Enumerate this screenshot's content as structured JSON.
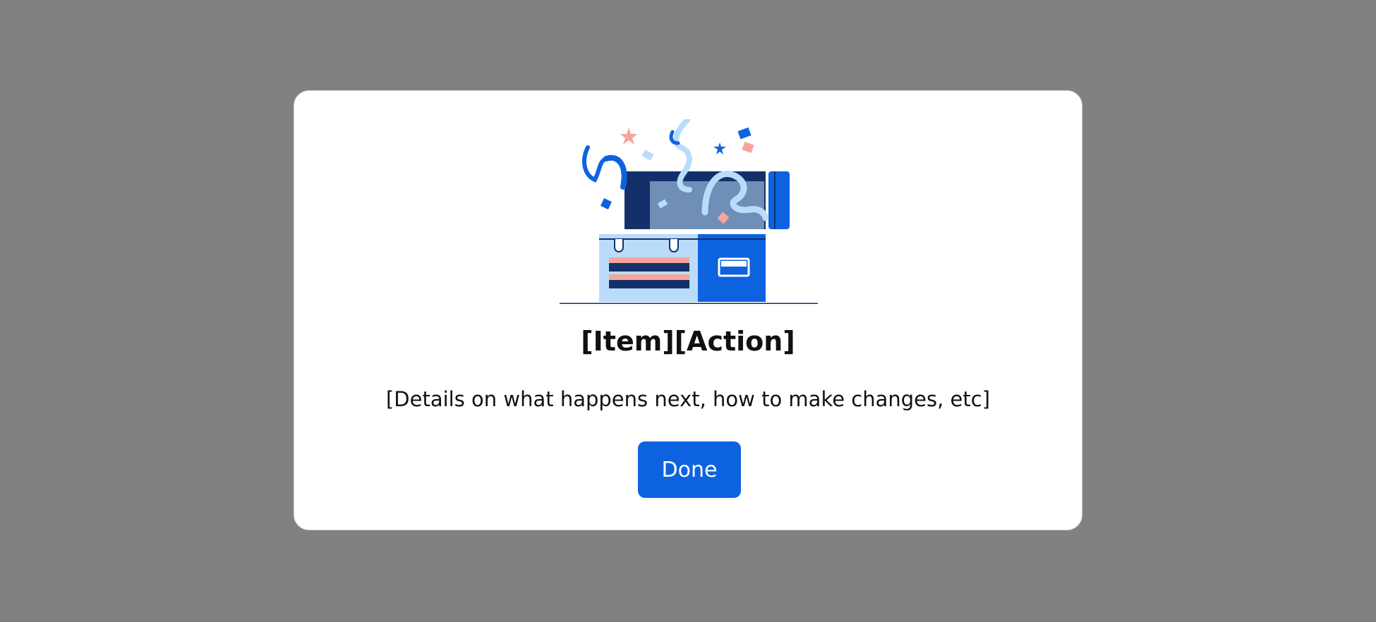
{
  "dialog": {
    "illustration_icon": "toolbox-confetti-illustration",
    "title": "[Item][Action]",
    "details": "[Details on what happens next, how to make changes, etc]",
    "done_label": "Done"
  },
  "colors": {
    "overlay": "#808183",
    "dialog_background": "#ffffff",
    "primary": "#0d63df",
    "navy": "#13306b",
    "light_blue": "#b9dcfb",
    "slate_blue": "#6f8fb6",
    "salmon": "#f7a59a"
  }
}
